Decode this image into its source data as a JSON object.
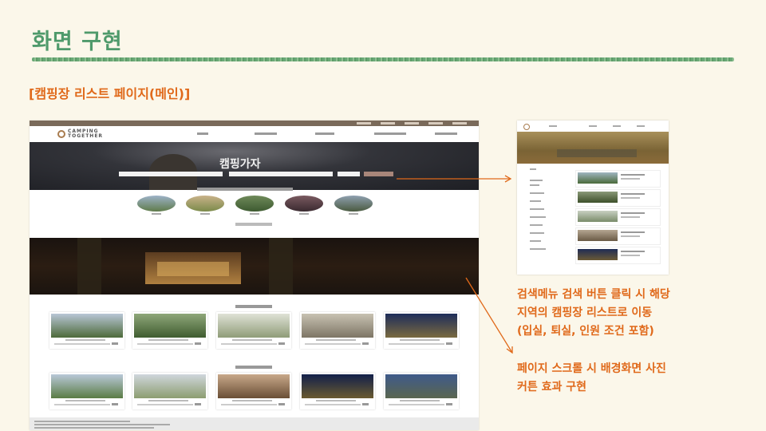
{
  "slide": {
    "title": "화면 구현",
    "subtitle": "[캠핑장 리스트 페이지(메인)]",
    "colors": {
      "title": "#4f9a6b",
      "accent": "#e0691a",
      "background": "#fbf7ea"
    }
  },
  "main_screenshot": {
    "logo_text": "CAMPING TOGETHER",
    "hero_title": "캠핑가자"
  },
  "notes": {
    "search_note": [
      "검색메뉴 검색 버튼 클릭 시 해당",
      "지역의 캠핑장 리스트로 이동",
      "(입실, 퇴실, 인원 조건 포함)"
    ],
    "scroll_note": [
      "페이지 스크롤 시 배경화면 사진",
      "커튼 효과 구현"
    ]
  },
  "icons": [
    "arrow-right-icon",
    "arrow-down-right-icon",
    "logo-icon"
  ]
}
